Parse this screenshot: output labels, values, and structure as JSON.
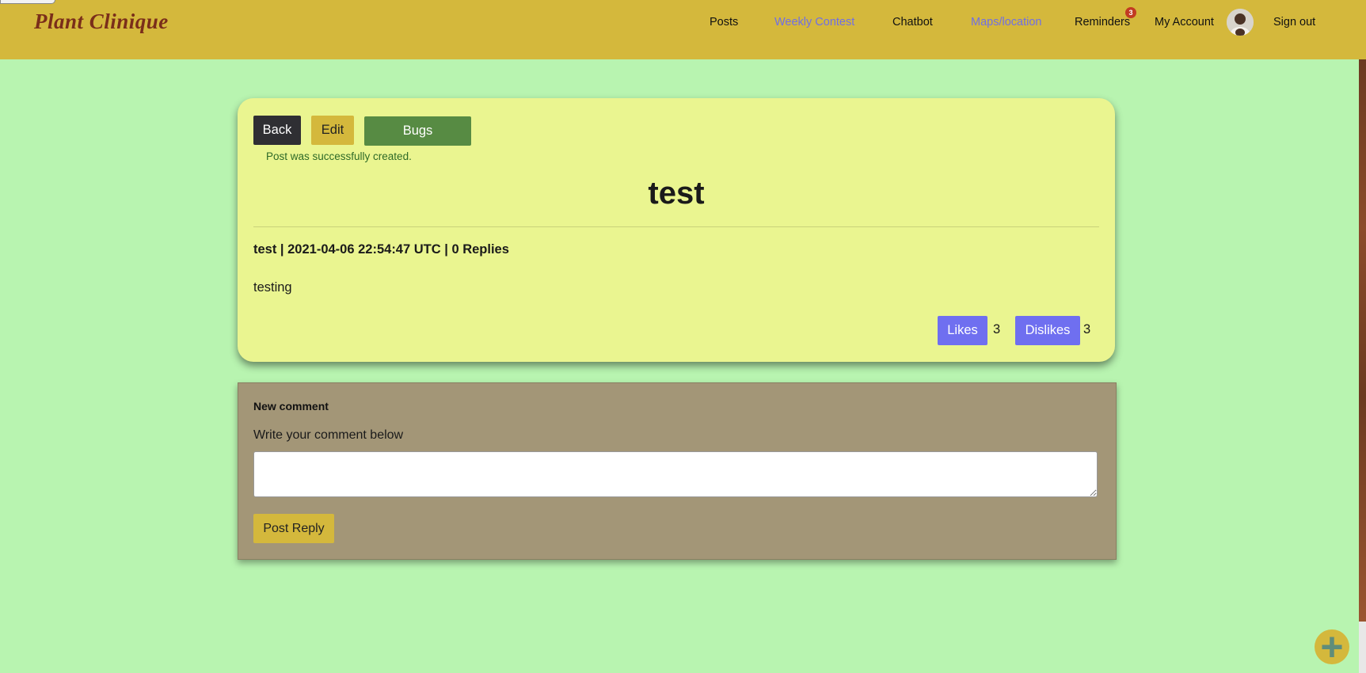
{
  "brand": {
    "name": "Plant Clinique"
  },
  "nav": {
    "posts": "Posts",
    "weekly_contest": "Weekly Contest",
    "chatbot": "Chatbot",
    "maps_location": "Maps/location",
    "reminders": "Reminders",
    "reminders_badge": "3",
    "my_account": "My Account",
    "sign_out": "Sign out"
  },
  "colors": {
    "navbar": "#d4b83c",
    "page_background": "#b8f4b0",
    "post_card": "#eaf590",
    "comment_card": "#a39677",
    "vote_buttons": "#6f6ff0",
    "bugs_button": "#578b43",
    "link_purple": "#6f6fe6"
  },
  "post": {
    "back_label": "Back",
    "edit_label": "Edit",
    "bugs_label": "Bugs",
    "notice": "Post was successfully created.",
    "title": "test",
    "meta": "test | 2021-04-06 22:54:47 UTC | 0 Replies",
    "body": "testing",
    "likes_label": "Likes",
    "likes_count": "3",
    "dislikes_label": "Dislikes",
    "dislikes_count": "3"
  },
  "comment": {
    "heading": "New comment",
    "label": "Write your comment below",
    "value": "",
    "submit_label": "Post Reply"
  },
  "icons": {
    "avatar": "user-avatar",
    "fab": "plus-icon"
  }
}
